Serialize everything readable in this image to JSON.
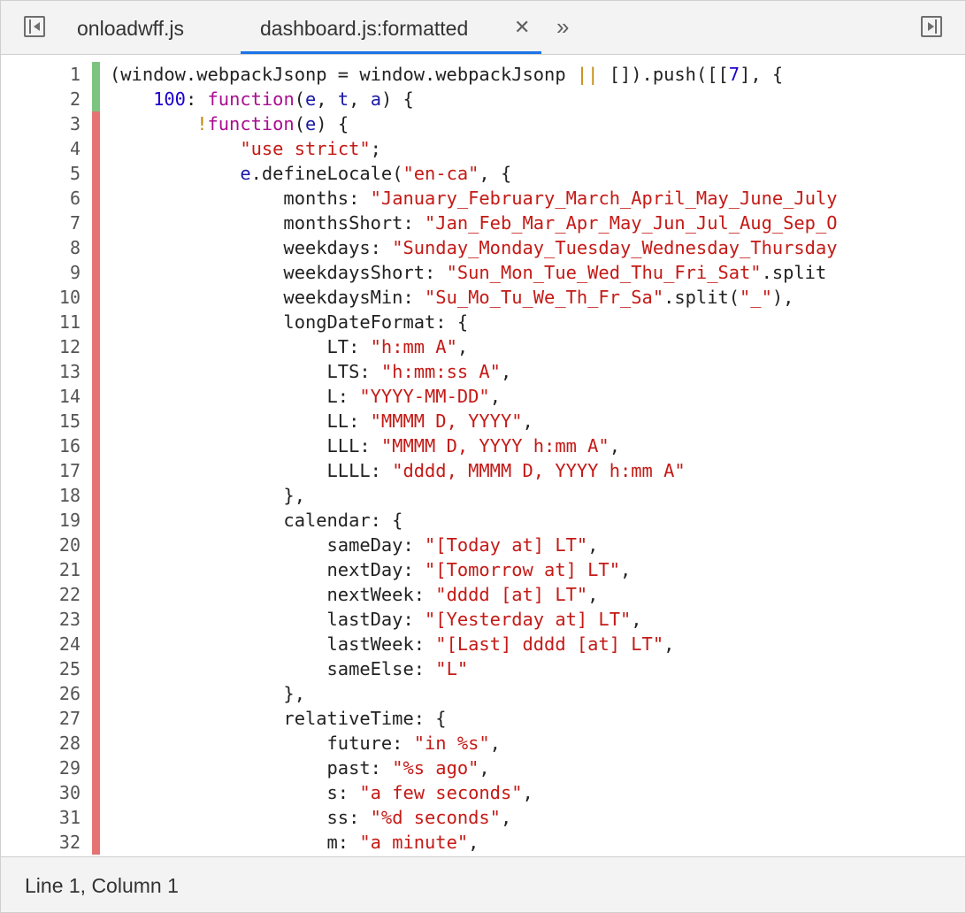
{
  "tabs": {
    "items": [
      {
        "label": "onloadwff.js"
      },
      {
        "label": "dashboard.js:formatted"
      }
    ],
    "close_glyph": "✕",
    "more_glyph": "»"
  },
  "icons": {
    "left": "toggle-navigator-icon",
    "right": "toggle-debugger-icon"
  },
  "colors": {
    "covered": "#7cc47f",
    "uncovered": "#e57373",
    "string": "#c41a16",
    "keyword": "#aa0d91",
    "number": "#1c00cf",
    "active_tab_underline": "#1a73e8"
  },
  "editor": {
    "lines": [
      {
        "n": "1",
        "cov": "green",
        "tokens": [
          [
            "p",
            "(window.webpackJsonp = window.webpackJsonp "
          ],
          [
            "op",
            "||"
          ],
          [
            "p",
            " []).push([["
          ],
          [
            "n",
            "7"
          ],
          [
            "p",
            "], {"
          ]
        ]
      },
      {
        "n": "2",
        "cov": "green",
        "tokens": [
          [
            "p",
            "    "
          ],
          [
            "n",
            "100"
          ],
          [
            "p",
            ": "
          ],
          [
            "k",
            "function"
          ],
          [
            "p",
            "("
          ],
          [
            "v",
            "e"
          ],
          [
            "p",
            ", "
          ],
          [
            "v",
            "t"
          ],
          [
            "p",
            ", "
          ],
          [
            "v",
            "a"
          ],
          [
            "p",
            ") {"
          ]
        ]
      },
      {
        "n": "3",
        "cov": "red",
        "tokens": [
          [
            "p",
            "        "
          ],
          [
            "op",
            "!"
          ],
          [
            "k",
            "function"
          ],
          [
            "p",
            "("
          ],
          [
            "v",
            "e"
          ],
          [
            "p",
            ") {"
          ]
        ]
      },
      {
        "n": "4",
        "cov": "red",
        "tokens": [
          [
            "p",
            "            "
          ],
          [
            "s",
            "\"use strict\""
          ],
          [
            "p",
            ";"
          ]
        ]
      },
      {
        "n": "5",
        "cov": "red",
        "tokens": [
          [
            "p",
            "            "
          ],
          [
            "v",
            "e"
          ],
          [
            "p",
            ".defineLocale("
          ],
          [
            "s",
            "\"en-ca\""
          ],
          [
            "p",
            ", {"
          ]
        ]
      },
      {
        "n": "6",
        "cov": "red",
        "tokens": [
          [
            "p",
            "                months: "
          ],
          [
            "s",
            "\"January_February_March_April_May_June_July"
          ]
        ]
      },
      {
        "n": "7",
        "cov": "red",
        "tokens": [
          [
            "p",
            "                monthsShort: "
          ],
          [
            "s",
            "\"Jan_Feb_Mar_Apr_May_Jun_Jul_Aug_Sep_O"
          ]
        ]
      },
      {
        "n": "8",
        "cov": "red",
        "tokens": [
          [
            "p",
            "                weekdays: "
          ],
          [
            "s",
            "\"Sunday_Monday_Tuesday_Wednesday_Thursday"
          ]
        ]
      },
      {
        "n": "9",
        "cov": "red",
        "tokens": [
          [
            "p",
            "                weekdaysShort: "
          ],
          [
            "s",
            "\"Sun_Mon_Tue_Wed_Thu_Fri_Sat\""
          ],
          [
            "p",
            ".split"
          ]
        ]
      },
      {
        "n": "10",
        "cov": "red",
        "tokens": [
          [
            "p",
            "                weekdaysMin: "
          ],
          [
            "s",
            "\"Su_Mo_Tu_We_Th_Fr_Sa\""
          ],
          [
            "p",
            ".split("
          ],
          [
            "s",
            "\"_\""
          ],
          [
            "p",
            "),"
          ]
        ]
      },
      {
        "n": "11",
        "cov": "red",
        "tokens": [
          [
            "p",
            "                longDateFormat: {"
          ]
        ]
      },
      {
        "n": "12",
        "cov": "red",
        "tokens": [
          [
            "p",
            "                    LT: "
          ],
          [
            "s",
            "\"h:mm A\""
          ],
          [
            "p",
            ","
          ]
        ]
      },
      {
        "n": "13",
        "cov": "red",
        "tokens": [
          [
            "p",
            "                    LTS: "
          ],
          [
            "s",
            "\"h:mm:ss A\""
          ],
          [
            "p",
            ","
          ]
        ]
      },
      {
        "n": "14",
        "cov": "red",
        "tokens": [
          [
            "p",
            "                    L: "
          ],
          [
            "s",
            "\"YYYY-MM-DD\""
          ],
          [
            "p",
            ","
          ]
        ]
      },
      {
        "n": "15",
        "cov": "red",
        "tokens": [
          [
            "p",
            "                    LL: "
          ],
          [
            "s",
            "\"MMMM D, YYYY\""
          ],
          [
            "p",
            ","
          ]
        ]
      },
      {
        "n": "16",
        "cov": "red",
        "tokens": [
          [
            "p",
            "                    LLL: "
          ],
          [
            "s",
            "\"MMMM D, YYYY h:mm A\""
          ],
          [
            "p",
            ","
          ]
        ]
      },
      {
        "n": "17",
        "cov": "red",
        "tokens": [
          [
            "p",
            "                    LLLL: "
          ],
          [
            "s",
            "\"dddd, MMMM D, YYYY h:mm A\""
          ]
        ]
      },
      {
        "n": "18",
        "cov": "red",
        "tokens": [
          [
            "p",
            "                },"
          ]
        ]
      },
      {
        "n": "19",
        "cov": "red",
        "tokens": [
          [
            "p",
            "                calendar: {"
          ]
        ]
      },
      {
        "n": "20",
        "cov": "red",
        "tokens": [
          [
            "p",
            "                    sameDay: "
          ],
          [
            "s",
            "\"[Today at] LT\""
          ],
          [
            "p",
            ","
          ]
        ]
      },
      {
        "n": "21",
        "cov": "red",
        "tokens": [
          [
            "p",
            "                    nextDay: "
          ],
          [
            "s",
            "\"[Tomorrow at] LT\""
          ],
          [
            "p",
            ","
          ]
        ]
      },
      {
        "n": "22",
        "cov": "red",
        "tokens": [
          [
            "p",
            "                    nextWeek: "
          ],
          [
            "s",
            "\"dddd [at] LT\""
          ],
          [
            "p",
            ","
          ]
        ]
      },
      {
        "n": "23",
        "cov": "red",
        "tokens": [
          [
            "p",
            "                    lastDay: "
          ],
          [
            "s",
            "\"[Yesterday at] LT\""
          ],
          [
            "p",
            ","
          ]
        ]
      },
      {
        "n": "24",
        "cov": "red",
        "tokens": [
          [
            "p",
            "                    lastWeek: "
          ],
          [
            "s",
            "\"[Last] dddd [at] LT\""
          ],
          [
            "p",
            ","
          ]
        ]
      },
      {
        "n": "25",
        "cov": "red",
        "tokens": [
          [
            "p",
            "                    sameElse: "
          ],
          [
            "s",
            "\"L\""
          ]
        ]
      },
      {
        "n": "26",
        "cov": "red",
        "tokens": [
          [
            "p",
            "                },"
          ]
        ]
      },
      {
        "n": "27",
        "cov": "red",
        "tokens": [
          [
            "p",
            "                relativeTime: {"
          ]
        ]
      },
      {
        "n": "28",
        "cov": "red",
        "tokens": [
          [
            "p",
            "                    future: "
          ],
          [
            "s",
            "\"in %s\""
          ],
          [
            "p",
            ","
          ]
        ]
      },
      {
        "n": "29",
        "cov": "red",
        "tokens": [
          [
            "p",
            "                    past: "
          ],
          [
            "s",
            "\"%s ago\""
          ],
          [
            "p",
            ","
          ]
        ]
      },
      {
        "n": "30",
        "cov": "red",
        "tokens": [
          [
            "p",
            "                    s: "
          ],
          [
            "s",
            "\"a few seconds\""
          ],
          [
            "p",
            ","
          ]
        ]
      },
      {
        "n": "31",
        "cov": "red",
        "tokens": [
          [
            "p",
            "                    ss: "
          ],
          [
            "s",
            "\"%d seconds\""
          ],
          [
            "p",
            ","
          ]
        ]
      },
      {
        "n": "32",
        "cov": "red",
        "tokens": [
          [
            "p",
            "                    m: "
          ],
          [
            "s",
            "\"a minute\""
          ],
          [
            "p",
            ","
          ]
        ]
      }
    ]
  },
  "status": {
    "cursor": "Line 1, Column 1"
  }
}
